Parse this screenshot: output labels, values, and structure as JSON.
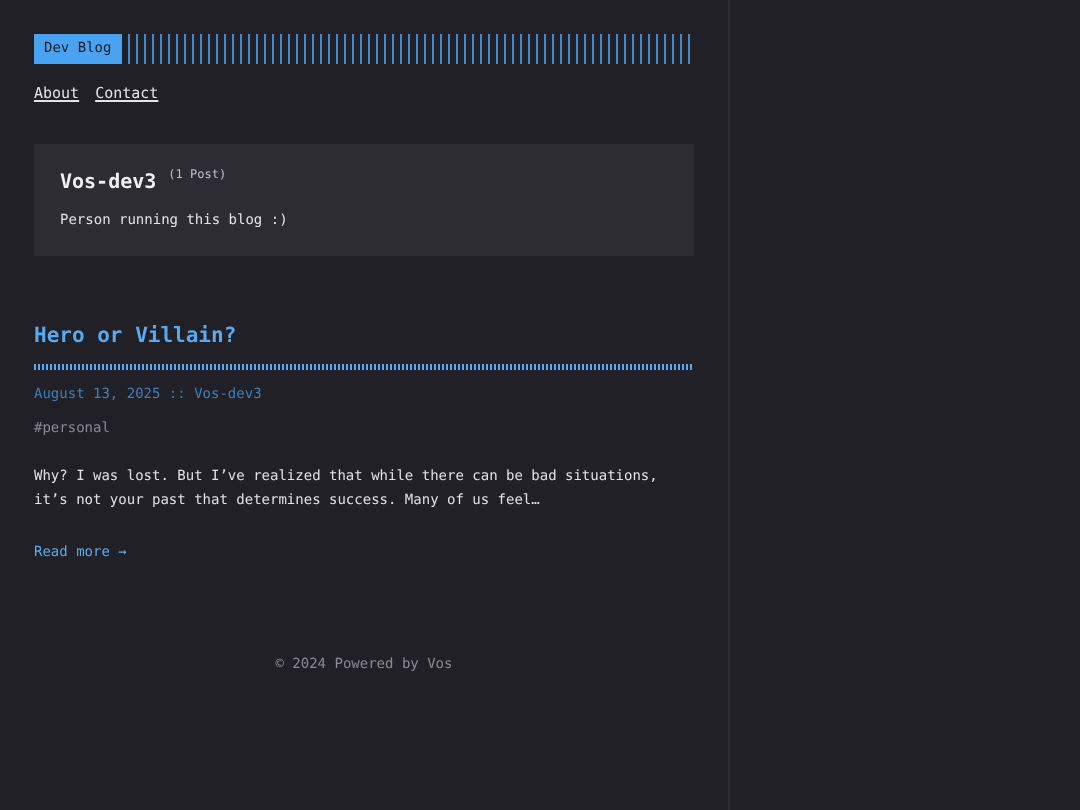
{
  "header": {
    "logo": "Dev Blog",
    "nav": [
      "About",
      "Contact"
    ]
  },
  "author_card": {
    "name": "Vos-dev3",
    "post_count": "(1 Post)",
    "bio": "Person running this blog :)"
  },
  "posts": [
    {
      "title": "Hero or Villain?",
      "meta": "August 13, 2025 :: Vos-dev3",
      "tags": [
        "#personal"
      ],
      "excerpt": "Why? I was lost. But I’ve realized that while there can be bad situations, it’s not your past that determines success. Many of us feel…",
      "read_more": "Read more →"
    }
  ],
  "footer": "© 2024 Powered by Vos"
}
